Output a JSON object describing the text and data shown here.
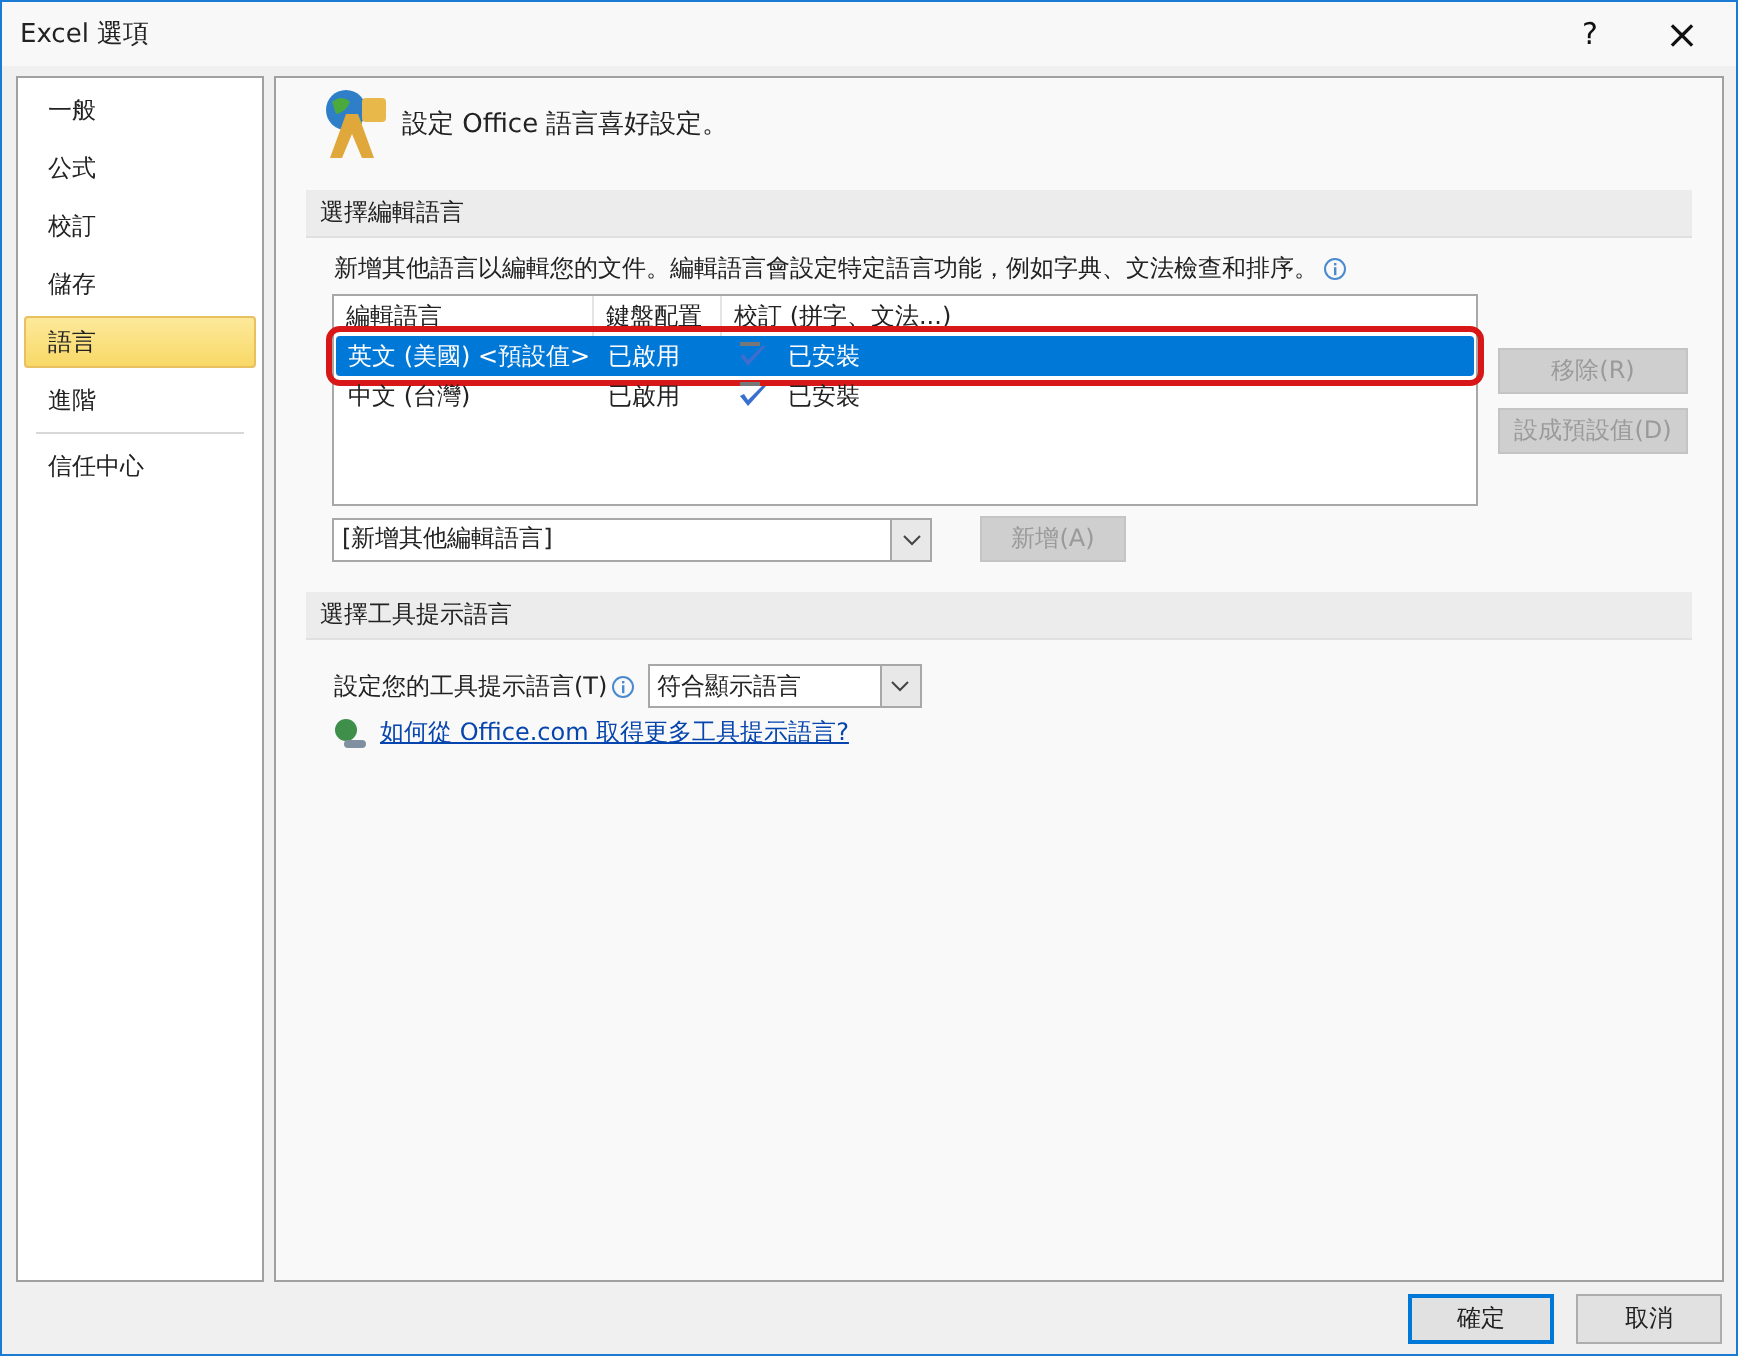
{
  "window": {
    "title": "Excel 選項",
    "help": "?",
    "close": "×"
  },
  "sidebar": {
    "groups": [
      {
        "items": [
          {
            "label": "一般",
            "selected": false
          },
          {
            "label": "公式",
            "selected": false
          },
          {
            "label": "校訂",
            "selected": false
          },
          {
            "label": "儲存",
            "selected": false
          },
          {
            "label": "語言",
            "selected": true
          },
          {
            "label": "進階",
            "selected": false
          }
        ]
      },
      {
        "items": [
          {
            "label": "信任中心",
            "selected": false
          }
        ]
      }
    ]
  },
  "header": "設定 Office 語言喜好設定。",
  "editing": {
    "title": "選擇編輯語言",
    "description": "新增其他語言以編輯您的文件。編輯語言會設定特定語言功能，例如字典、文法檢查和排序。",
    "columns": [
      "編輯語言",
      "鍵盤配置",
      "校訂 (拼字、文法...)"
    ],
    "rows": [
      {
        "language": "英文 (美國) <預設值>",
        "keyboard": "已啟用",
        "proofing": "已安裝",
        "selected": true,
        "highlighted": true
      },
      {
        "language": "中文 (台灣)",
        "keyboard": "已啟用",
        "proofing": "已安裝",
        "selected": false,
        "highlighted": false
      }
    ],
    "side_buttons": [
      {
        "label": "移除(R)",
        "disabled": true
      },
      {
        "label": "設成預設值(D)",
        "disabled": true
      }
    ],
    "add_dropdown": {
      "value": "[新增其他編輯語言]"
    },
    "add_button": {
      "label": "新增(A)",
      "disabled": true
    }
  },
  "tooltip": {
    "title": "選擇工具提示語言",
    "label": "設定您的工具提示語言(T)",
    "select": {
      "value": "符合顯示語言"
    },
    "link": "如何從 Office.com 取得更多工具提示語言?"
  },
  "footer": {
    "buttons": [
      {
        "label": "確定",
        "default": true
      },
      {
        "label": "取消",
        "default": false
      }
    ]
  }
}
